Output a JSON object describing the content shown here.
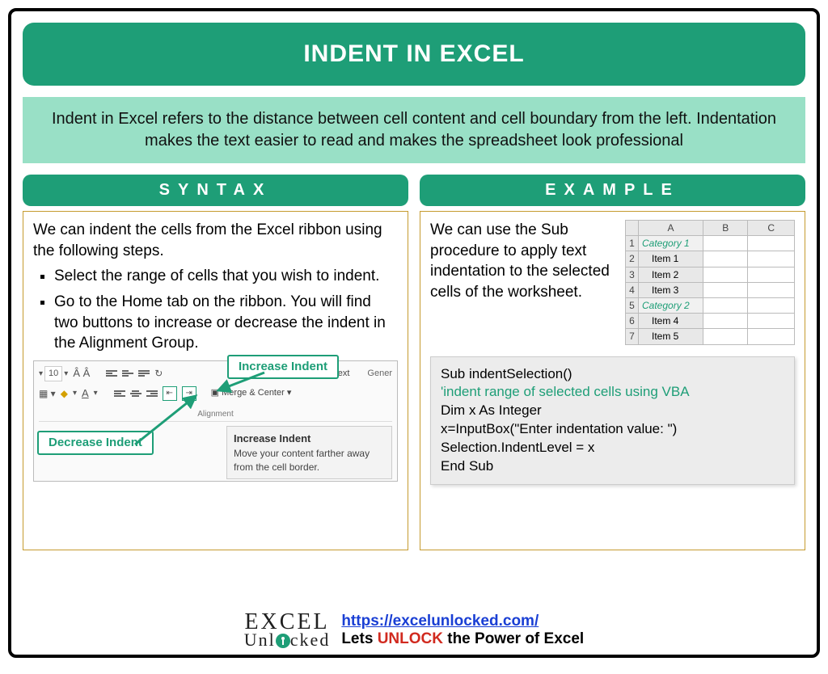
{
  "title": "INDENT IN EXCEL",
  "description": "Indent in Excel refers to the distance between cell content and cell boundary from the left. Indentation makes the text easier to read and makes the spreadsheet look professional",
  "syntax": {
    "heading": "SYNTAX",
    "intro": "We can indent the cells from the Excel ribbon using the following steps.",
    "bullets": [
      "Select the range of cells that you wish to indent.",
      "Go to the Home tab on the ribbon. You will find two buttons to increase or decrease the indent in the Alignment Group."
    ],
    "ribbon": {
      "font_size": "10",
      "wrap_text": "Wrap Text",
      "merge_center": "Merge & Center",
      "group_label": "Alignment",
      "general_label": "Gener",
      "increase_label": "Increase Indent",
      "decrease_label": "Decrease Indent",
      "tooltip_title": "Increase Indent",
      "tooltip_body": "Move your content farther away from the cell border."
    }
  },
  "example": {
    "heading": "EXAMPLE",
    "intro": "We can use the Sub procedure to apply text indentation to the selected cells of the worksheet.",
    "sheet": {
      "cols": [
        "A",
        "B",
        "C"
      ],
      "rows": [
        {
          "n": "1",
          "a": "Category 1",
          "cls": "cat"
        },
        {
          "n": "2",
          "a": "Item 1",
          "cls": "item"
        },
        {
          "n": "3",
          "a": "Item 2",
          "cls": "item"
        },
        {
          "n": "4",
          "a": "Item 3",
          "cls": "item"
        },
        {
          "n": "5",
          "a": "Category 2",
          "cls": "cat"
        },
        {
          "n": "6",
          "a": "Item 4",
          "cls": "item"
        },
        {
          "n": "7",
          "a": "Item 5",
          "cls": "item"
        }
      ]
    },
    "code": {
      "l1": "Sub indentSelection()",
      "l2": "'indent range of selected cells using VBA",
      "l3": "Dim x As Integer",
      "l4": "x=InputBox(\"Enter indentation value: \")",
      "l5": "Selection.IndentLevel = x",
      "l6": "End Sub"
    }
  },
  "footer": {
    "logo_top": "EXCEL",
    "logo_bottom_left": "Unl",
    "logo_bottom_right": "cked",
    "url": "https://excelunlocked.com/",
    "tagline_pre": "Lets ",
    "tagline_em": "UNLOCK",
    "tagline_post": " the Power of Excel"
  }
}
